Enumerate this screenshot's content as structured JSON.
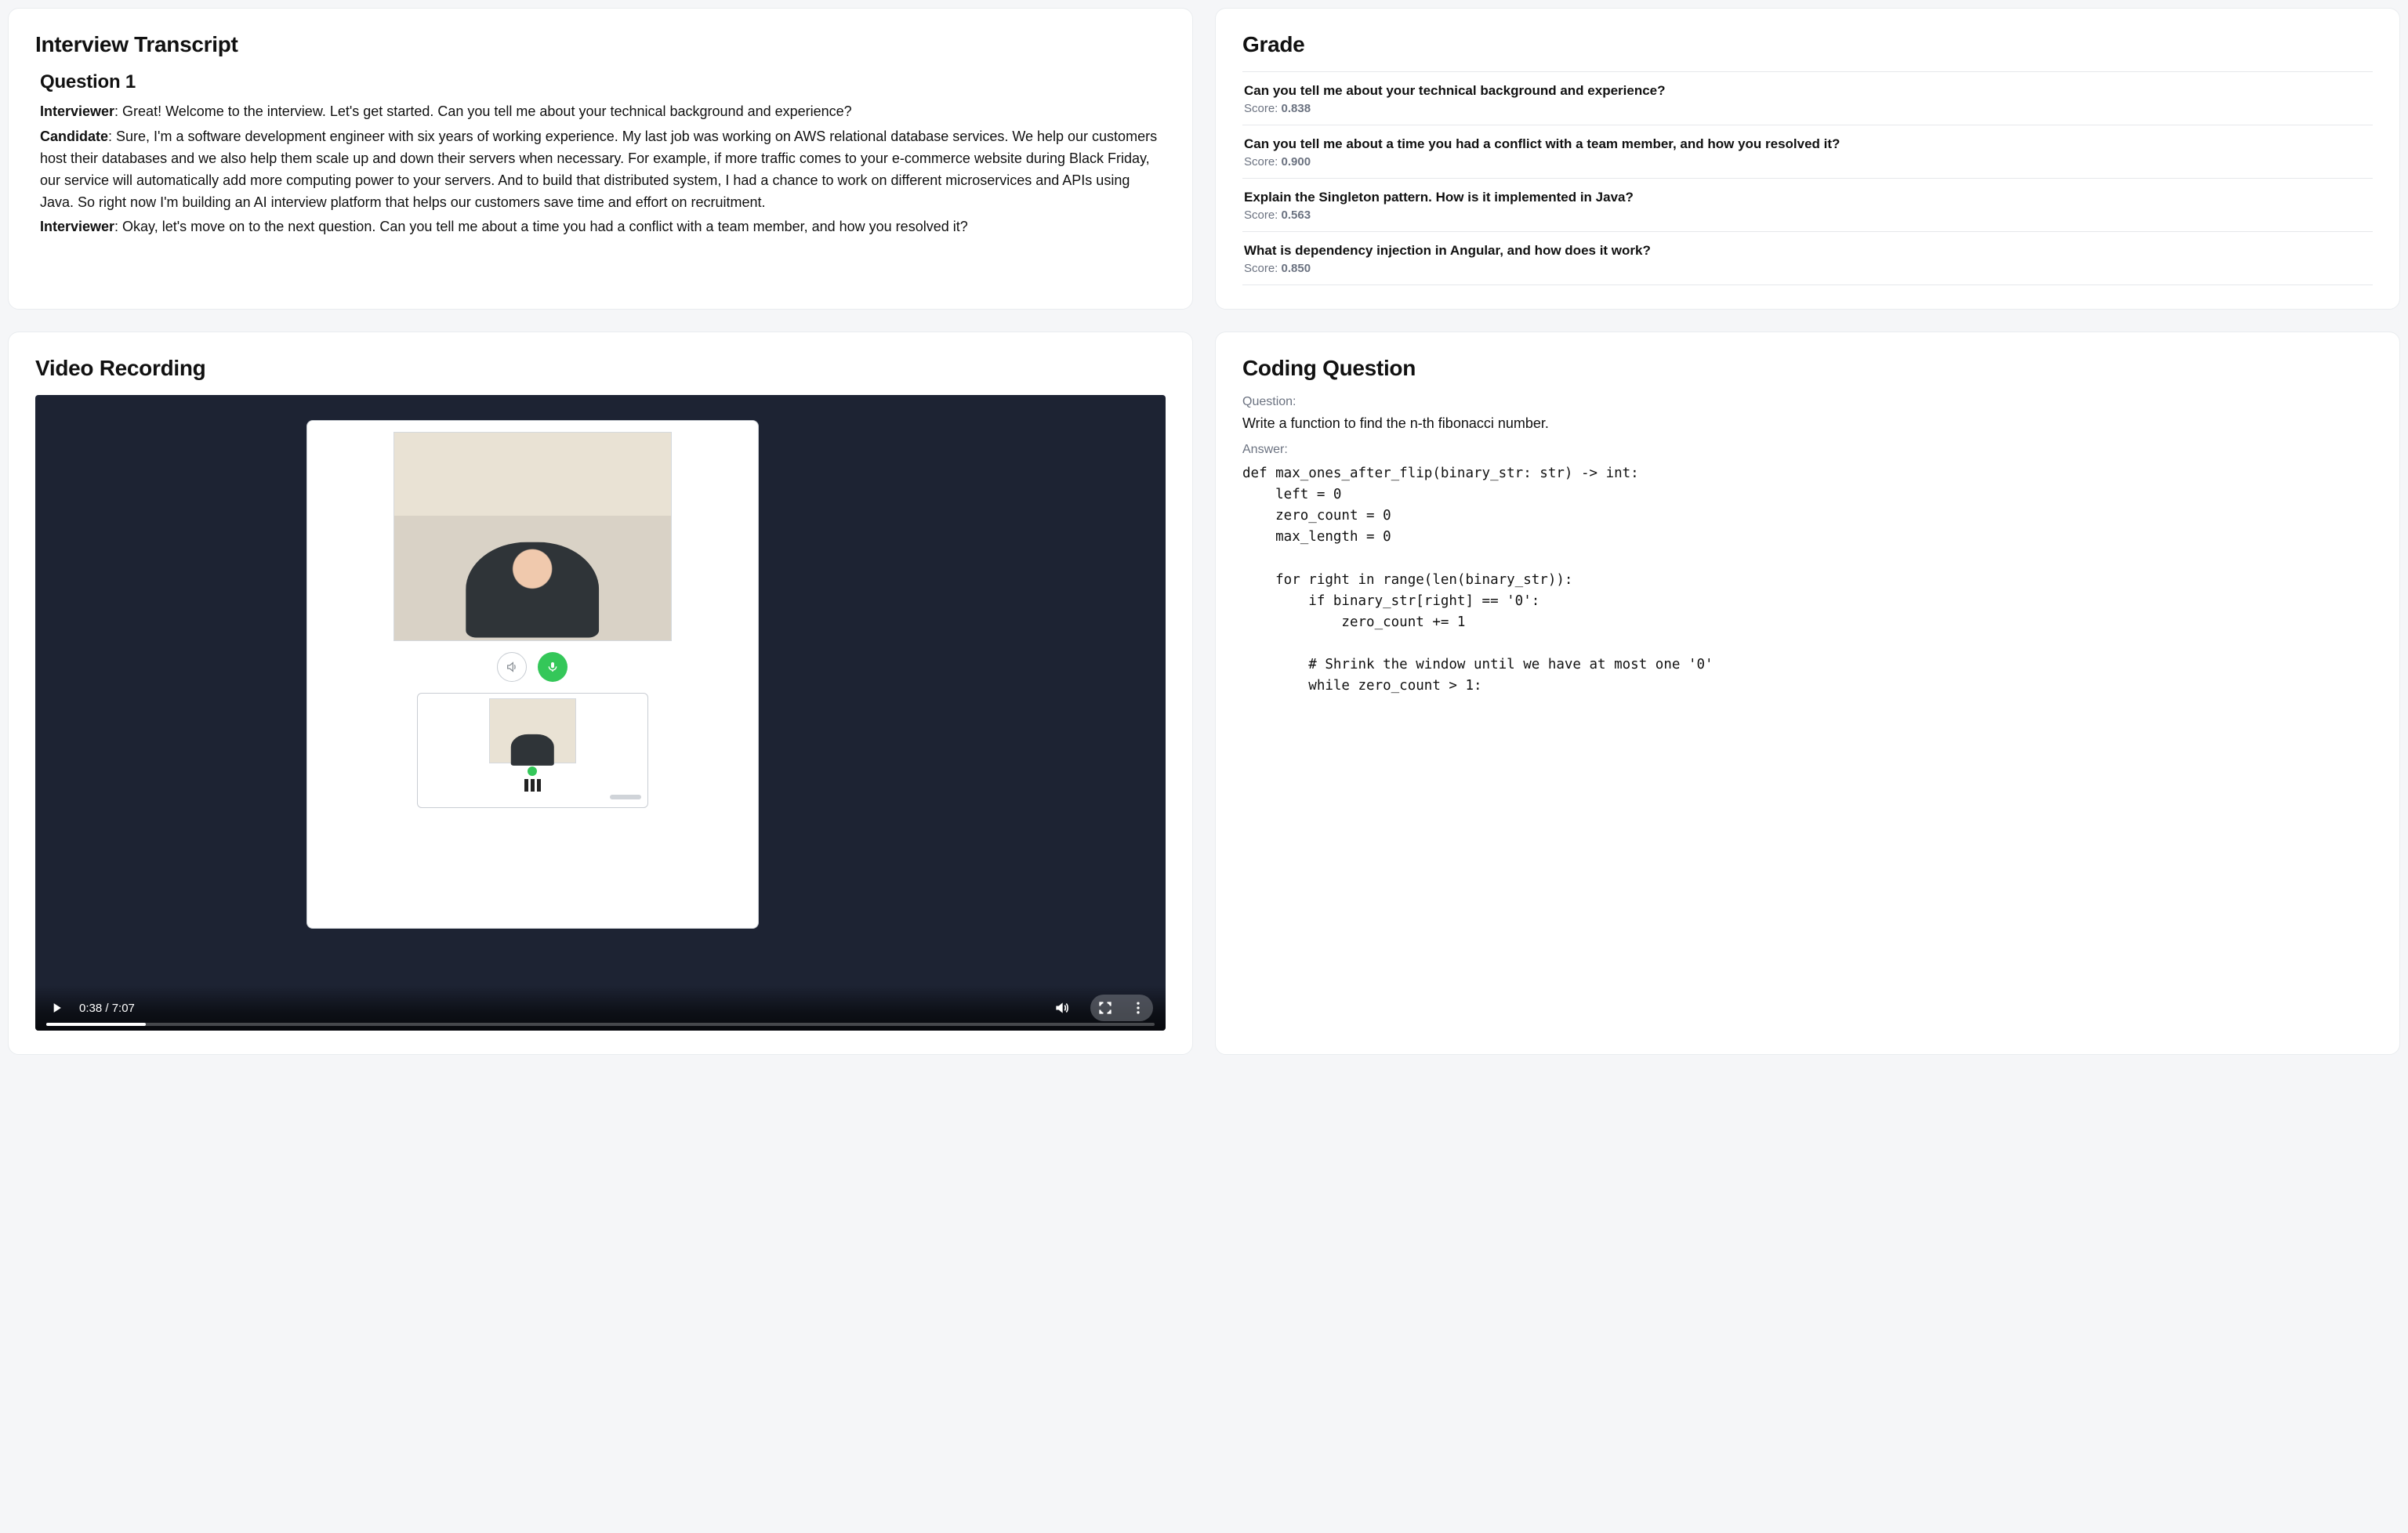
{
  "transcript": {
    "panel_title": "Interview Transcript",
    "question_heading": "Question 1",
    "turns": [
      {
        "role": "Interviewer",
        "text": ": Great! Welcome to the interview. Let's get started. Can you tell me about your technical background and experience?"
      },
      {
        "role": "Candidate",
        "text": ": Sure, I'm a software development engineer with six years of working experience. My last job was working on AWS relational database services. We help our customers host their databases and we also help them scale up and down their servers when necessary. For example, if more traffic comes to your e-commerce website during Black Friday, our service will automatically add more computing power to your servers. And to build that distributed system, I had a chance to work on different microservices and APIs using Java. So right now I'm building an AI interview platform that helps our customers save time and effort on recruitment."
      },
      {
        "role": "Interviewer",
        "text": ": Okay, let's move on to the next question. Can you tell me about a time you had a conflict with a team member, and how you resolved it?"
      }
    ]
  },
  "grade": {
    "panel_title": "Grade",
    "score_label": "Score: ",
    "items": [
      {
        "question": "Can you tell me about your technical background and experience?",
        "score": "0.838"
      },
      {
        "question": "Can you tell me about a time you had a conflict with a team member, and how you resolved it?",
        "score": "0.900"
      },
      {
        "question": "Explain the Singleton pattern. How is it implemented in Java?",
        "score": "0.563"
      },
      {
        "question": "What is dependency injection in Angular, and how does it work?",
        "score": "0.850"
      }
    ]
  },
  "video": {
    "panel_title": "Video Recording",
    "time_label": "0:38 / 7:07",
    "progress_pct": 9
  },
  "coding": {
    "panel_title": "Coding Question",
    "question_label": "Question:",
    "question_text": "Write a function to find the n-th fibonacci number.",
    "answer_label": "Answer:",
    "code": "def max_ones_after_flip(binary_str: str) -> int:\n    left = 0\n    zero_count = 0\n    max_length = 0\n\n    for right in range(len(binary_str)):\n        if binary_str[right] == '0':\n            zero_count += 1\n\n        # Shrink the window until we have at most one '0'\n        while zero_count > 1:"
  }
}
